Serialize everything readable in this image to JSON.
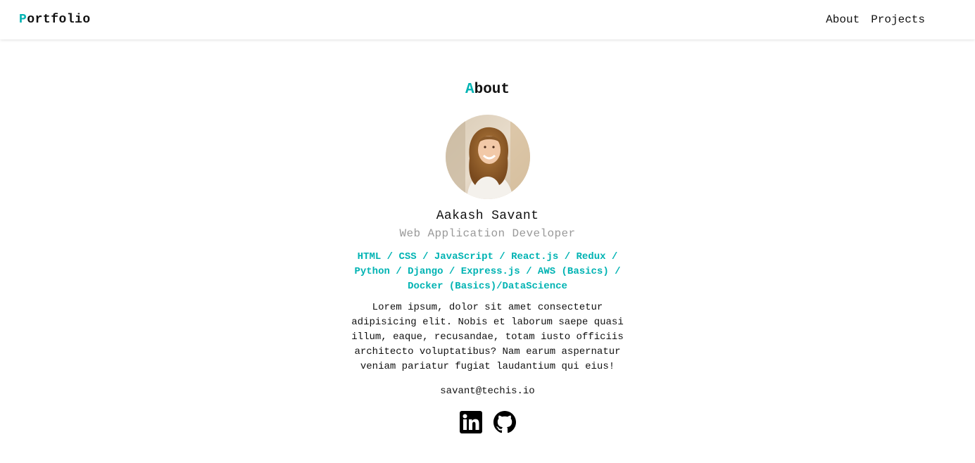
{
  "navbar": {
    "brand_first": "P",
    "brand_rest": "ortfolio",
    "links": [
      {
        "label": "About"
      },
      {
        "label": "Projects"
      }
    ]
  },
  "about": {
    "title_first": "A",
    "title_rest": "bout",
    "avatar_icon": "profile-photo",
    "name": "Aakash Savant",
    "role": "Web Application Developer",
    "skills": "HTML / CSS / JavaScript / React.js / Redux / Python / Django / Express.js / AWS (Basics) / Docker (Basics)/DataScience",
    "bio": "Lorem ipsum, dolor sit amet consectetur adipisicing elit. Nobis et laborum saepe quasi illum, eaque, recusandae, totam iusto officiis architecto voluptatibus? Nam earum aspernatur veniam pariatur fugiat laudantium qui eius!",
    "email": "savant@techis.io",
    "socials": [
      {
        "icon": "linkedin-icon"
      },
      {
        "icon": "github-icon"
      }
    ]
  },
  "colors": {
    "accent": "#00b3b3",
    "text": "#111111",
    "muted": "#999999"
  }
}
